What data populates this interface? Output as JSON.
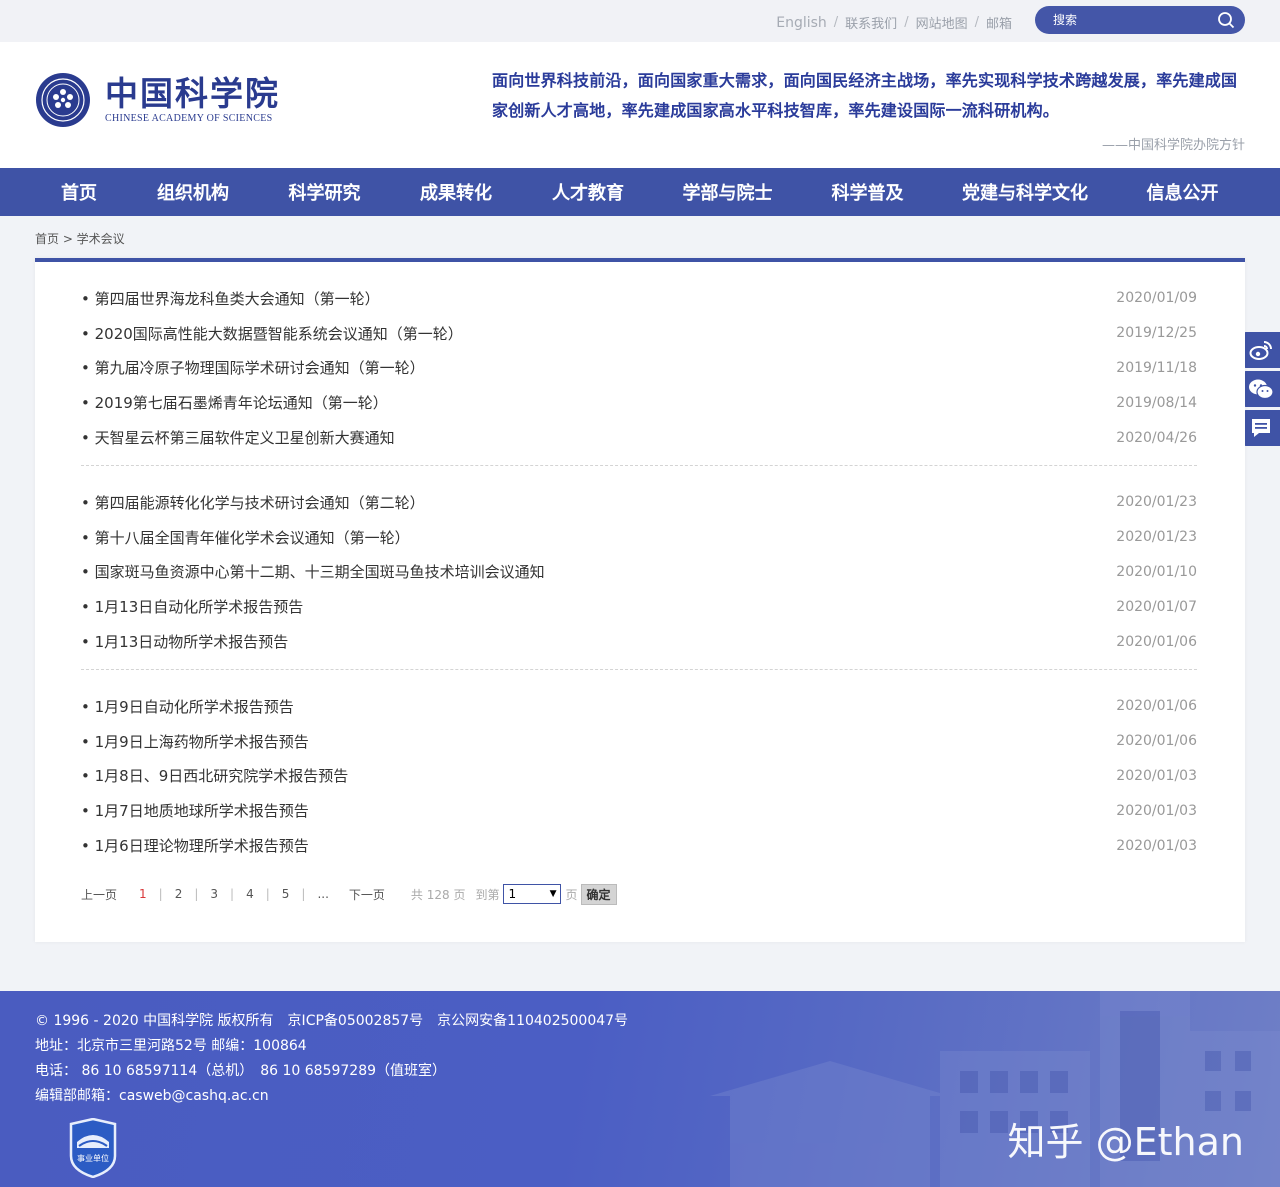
{
  "topbar": {
    "english": "English",
    "links": [
      "联系我们",
      "网站地图",
      "邮箱"
    ],
    "search_placeholder": "搜索"
  },
  "header": {
    "logo_cn": "中国科学院",
    "logo_en": "CHINESE ACADEMY OF SCIENCES",
    "motto": "面向世界科技前沿，面向国家重大需求，面向国民经济主战场，率先实现科学技术跨越发展，率先建成国家创新人才高地，率先建成国家高水平科技智库，率先建设国际一流科研机构。",
    "motto_source": "——中国科学院办院方针"
  },
  "nav": [
    "首页",
    "组织机构",
    "科学研究",
    "成果转化",
    "人才教育",
    "学部与院士",
    "科学普及",
    "党建与科学文化",
    "信息公开"
  ],
  "breadcrumb": "首页 > 学术会议",
  "groups": [
    [
      {
        "title": "• 第四届世界海龙科鱼类大会通知（第一轮）",
        "date": "2020/01/09"
      },
      {
        "title": "• 2020国际高性能大数据暨智能系统会议通知（第一轮）",
        "date": "2019/12/25"
      },
      {
        "title": "• 第九届冷原子物理国际学术研讨会通知（第一轮）",
        "date": "2019/11/18"
      },
      {
        "title": "• 2019第七届石墨烯青年论坛通知（第一轮）",
        "date": "2019/08/14"
      },
      {
        "title": "• 天智星云杯第三届软件定义卫星创新大赛通知",
        "date": "2020/04/26"
      }
    ],
    [
      {
        "title": "• 第四届能源转化化学与技术研讨会通知（第二轮）",
        "date": "2020/01/23"
      },
      {
        "title": "• 第十八届全国青年催化学术会议通知（第一轮）",
        "date": "2020/01/23"
      },
      {
        "title": "• 国家斑马鱼资源中心第十二期、十三期全国斑马鱼技术培训会议通知",
        "date": "2020/01/10"
      },
      {
        "title": "• 1月13日自动化所学术报告预告",
        "date": "2020/01/07"
      },
      {
        "title": "• 1月13日动物所学术报告预告",
        "date": "2020/01/06"
      }
    ],
    [
      {
        "title": "• 1月9日自动化所学术报告预告",
        "date": "2020/01/06"
      },
      {
        "title": "• 1月9日上海药物所学术报告预告",
        "date": "2020/01/06"
      },
      {
        "title": "• 1月8日、9日西北研究院学术报告预告",
        "date": "2020/01/03"
      },
      {
        "title": "• 1月7日地质地球所学术报告预告",
        "date": "2020/01/03"
      },
      {
        "title": "• 1月6日理论物理所学术报告预告",
        "date": "2020/01/03"
      }
    ]
  ],
  "pager": {
    "prev": "上一页",
    "pages": [
      "1",
      "2",
      "3",
      "4",
      "5",
      "..."
    ],
    "next": "下一页",
    "total": "共 128 页",
    "goto": "到第",
    "page_value": "1",
    "page_unit": "页",
    "confirm": "确定"
  },
  "side": [
    "weibo-icon",
    "wechat-icon",
    "feedback-icon"
  ],
  "footer": {
    "copyright": "© 1996 - 2020 中国科学院 版权所有　京ICP备05002857号　京公网安备110402500047号",
    "address": "地址：北京市三里河路52号 邮编：100864",
    "phone": "电话： 86 10 68597114（总机）　86 10 68597289（值班室）",
    "email": "编辑部邮箱：casweb@cashq.ac.cn",
    "badge": "事业单位",
    "watermark": "知乎 @Ethan"
  },
  "colors": {
    "primary": "#3f53a6",
    "footer": "#4a5cc0",
    "current_page": "#d9383a"
  }
}
